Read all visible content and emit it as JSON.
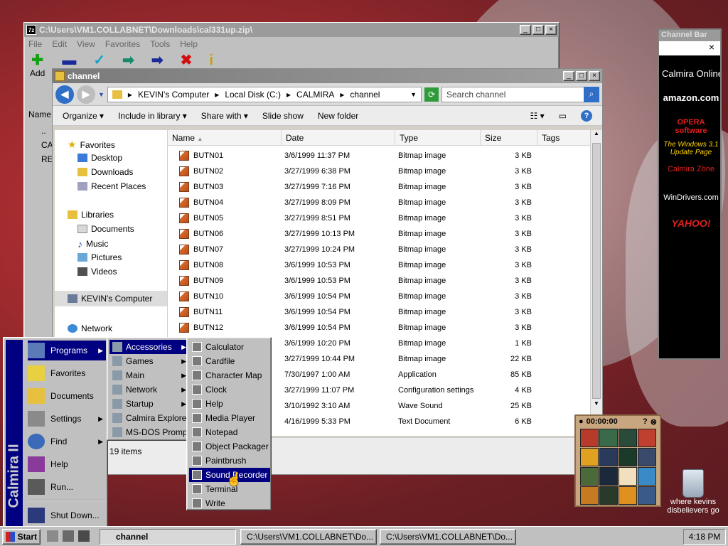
{
  "win1": {
    "title": "C:\\Users\\VM1.COLLABNET\\Downloads\\cal331up.zip\\",
    "menu": [
      "File",
      "Edit",
      "View",
      "Favorites",
      "Tools",
      "Help"
    ],
    "tools": [
      {
        "label": "Add",
        "icon": "add-icon"
      }
    ],
    "side_labels": {
      "name": "Name",
      "ca": "CA",
      "re": "RE",
      "dots": ".."
    }
  },
  "win2": {
    "title": "channel",
    "address": [
      "KEVIN's Computer",
      "Local Disk (C:)",
      "CALMIRA",
      "channel"
    ],
    "search_placeholder": "Search channel",
    "commands": [
      "Organize",
      "Include in library",
      "Share with",
      "Slide show",
      "New folder"
    ],
    "nav": {
      "favorites": "Favorites",
      "desktop": "Desktop",
      "downloads": "Downloads",
      "recent": "Recent Places",
      "libraries": "Libraries",
      "documents": "Documents",
      "music": "Music",
      "pictures": "Pictures",
      "videos": "Videos",
      "computer": "KEVIN's Computer",
      "network": "Network"
    },
    "columns": [
      "Name",
      "Date",
      "Type",
      "Size",
      "Tags"
    ],
    "files": [
      {
        "name": "BUTN01",
        "date": "3/6/1999 11:37 PM",
        "type": "Bitmap image",
        "size": "3 KB"
      },
      {
        "name": "BUTN02",
        "date": "3/27/1999 6:38 PM",
        "type": "Bitmap image",
        "size": "3 KB"
      },
      {
        "name": "BUTN03",
        "date": "3/27/1999 7:16 PM",
        "type": "Bitmap image",
        "size": "3 KB"
      },
      {
        "name": "BUTN04",
        "date": "3/27/1999 8:09 PM",
        "type": "Bitmap image",
        "size": "3 KB"
      },
      {
        "name": "BUTN05",
        "date": "3/27/1999 8:51 PM",
        "type": "Bitmap image",
        "size": "3 KB"
      },
      {
        "name": "BUTN06",
        "date": "3/27/1999 10:13 PM",
        "type": "Bitmap image",
        "size": "3 KB"
      },
      {
        "name": "BUTN07",
        "date": "3/27/1999 10:24 PM",
        "type": "Bitmap image",
        "size": "3 KB"
      },
      {
        "name": "BUTN08",
        "date": "3/6/1999 10:53 PM",
        "type": "Bitmap image",
        "size": "3 KB"
      },
      {
        "name": "BUTN09",
        "date": "3/6/1999 10:53 PM",
        "type": "Bitmap image",
        "size": "3 KB"
      },
      {
        "name": "BUTN10",
        "date": "3/6/1999 10:54 PM",
        "type": "Bitmap image",
        "size": "3 KB"
      },
      {
        "name": "BUTN11",
        "date": "3/6/1999 10:54 PM",
        "type": "Bitmap image",
        "size": "3 KB"
      },
      {
        "name": "BUTN12",
        "date": "3/6/1999 10:54 PM",
        "type": "Bitmap image",
        "size": "3 KB"
      },
      {
        "name": "",
        "date": "3/6/1999 10:20 PM",
        "type": "Bitmap image",
        "size": "1 KB"
      },
      {
        "name": "",
        "date": "3/27/1999 10:44 PM",
        "type": "Bitmap image",
        "size": "22 KB"
      },
      {
        "name": "",
        "date": "7/30/1997 1:00 AM",
        "type": "Application",
        "size": "85 KB"
      },
      {
        "name": "",
        "date": "3/27/1999 11:07 PM",
        "type": "Configuration settings",
        "size": "4 KB"
      },
      {
        "name": "",
        "date": "3/10/1992 3:10 AM",
        "type": "Wave Sound",
        "size": "25 KB"
      },
      {
        "name": "",
        "date": "4/16/1999 5:33 PM",
        "type": "Text Document",
        "size": "6 KB"
      }
    ],
    "status": "19 items"
  },
  "channel_bar": {
    "title": "Channel Bar",
    "close": "×",
    "items": [
      {
        "label": "Calmira Online",
        "color": "#ffffff"
      },
      {
        "label": "amazon.com",
        "color": "#ffffff"
      },
      {
        "label": "OPERA software",
        "color": "#e02020"
      },
      {
        "label": "The Windows 3.1 Update Page",
        "color": "#ffd400"
      },
      {
        "label": "Calmira Zone",
        "color": "#e02020"
      },
      {
        "label": "WinDrivers.com",
        "color": "#ffffff"
      },
      {
        "label": "YAHOO!",
        "color": "#e02020"
      }
    ]
  },
  "puzzle": {
    "time": "00:00:00"
  },
  "recycle": {
    "label": "where kevins disbelievers go"
  },
  "start_menu": {
    "brand": "Calmira II",
    "items": [
      "Programs",
      "Favorites",
      "Documents",
      "Settings",
      "Find",
      "Help",
      "Run...",
      "Shut Down..."
    ]
  },
  "programs_menu": [
    "Accessories",
    "Games",
    "Main",
    "Network",
    "Startup",
    "Calmira Explorer",
    "MS-DOS Prompt"
  ],
  "accessories_menu": [
    "Calculator",
    "Cardfile",
    "Character Map",
    "Clock",
    "Help",
    "Media Player",
    "Notepad",
    "Object Packager",
    "Paintbrush",
    "Sound Recorder",
    "Terminal",
    "Write"
  ],
  "taskbar": {
    "start": "Start",
    "tasks": [
      "channel",
      "C:\\Users\\VM1.COLLABNET\\Do...",
      "C:\\Users\\VM1.COLLABNET\\Do..."
    ],
    "clock": "4:18 PM"
  }
}
